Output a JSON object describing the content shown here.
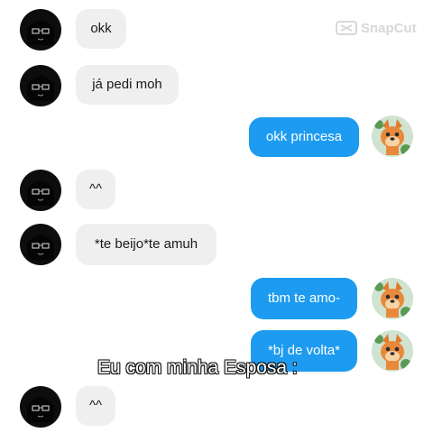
{
  "watermark": {
    "text": "SnapCut",
    "icon": "scissors-logo"
  },
  "caption": "Eu com minha Esposa :",
  "messages": [
    {
      "side": "received",
      "text": "okk"
    },
    {
      "side": "received",
      "text": "já pedi moh"
    },
    {
      "side": "sent",
      "text": "okk princesa"
    },
    {
      "side": "received",
      "text": "^^"
    },
    {
      "side": "received",
      "text": "*te beijo*te amuh"
    },
    {
      "side": "sent",
      "text": "tbm te amo-"
    },
    {
      "side": "sent",
      "text": "*bj de volta*"
    },
    {
      "side": "received",
      "text": "^^"
    }
  ],
  "colors": {
    "sent_bubble": "#1d9bf0",
    "received_bubble": "#efefef",
    "background": "#ffffff"
  },
  "avatars": {
    "received": "dark-haired-girl-avatar",
    "sent": "cartoon-dog-avatar"
  }
}
